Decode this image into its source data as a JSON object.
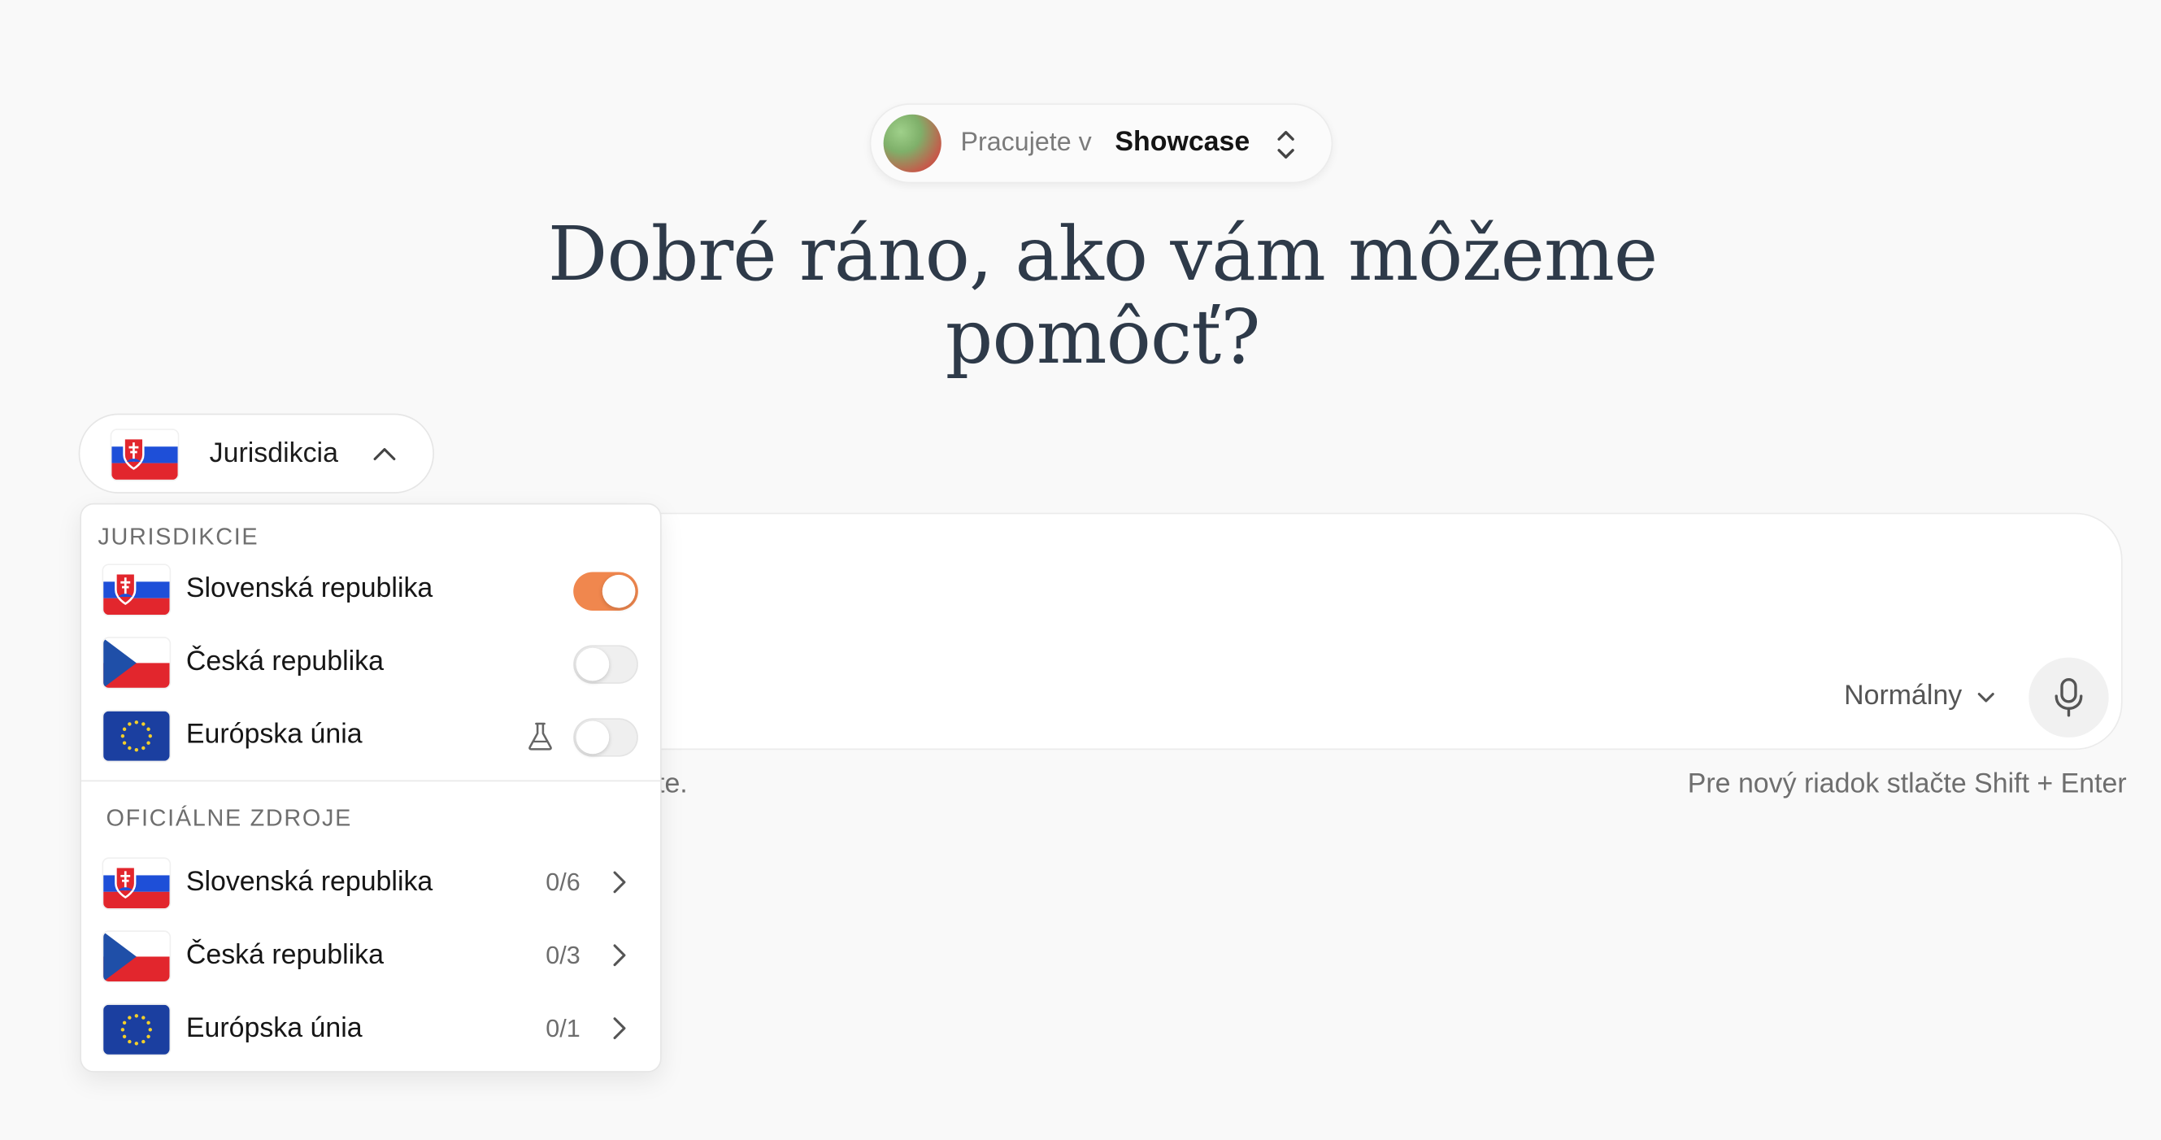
{
  "workspace": {
    "prefix": "Pracujete v",
    "name": "Showcase"
  },
  "headline": {
    "line1": "Dobré ráno, ako vám môžeme",
    "line2": "pomôcť?"
  },
  "jurisdiction_button": {
    "label": "Jurisdikcia",
    "flag": "slovakia-flag"
  },
  "dropdown": {
    "jurisdictions_title": "JURISDIKCIE",
    "jurisdictions": [
      {
        "label": "Slovenská republika",
        "flag": "slovakia-flag",
        "enabled": true
      },
      {
        "label": "Česká republika",
        "flag": "czech-flag",
        "enabled": false
      },
      {
        "label": "Európska únia",
        "flag": "eu-flag",
        "enabled": false,
        "beta_icon": "flask-icon"
      }
    ],
    "sources_title": "OFICIÁLNE ZDROJE",
    "sources": [
      {
        "label": "Slovenská republika",
        "flag": "slovakia-flag",
        "count": "0/6"
      },
      {
        "label": "Česká republika",
        "flag": "czech-flag",
        "count": "0/3"
      },
      {
        "label": "Európska únia",
        "flag": "eu-flag",
        "count": "0/1"
      }
    ]
  },
  "composer": {
    "mode": "Normálny",
    "mic_icon": "microphone-icon",
    "hint_left_visible": "rte.",
    "hint_right": "Pre nový riadok stlačte Shift + Enter"
  },
  "colors": {
    "accent_toggle": "#f0874e",
    "headline": "#2e3a49",
    "background": "#f9f9f9"
  }
}
